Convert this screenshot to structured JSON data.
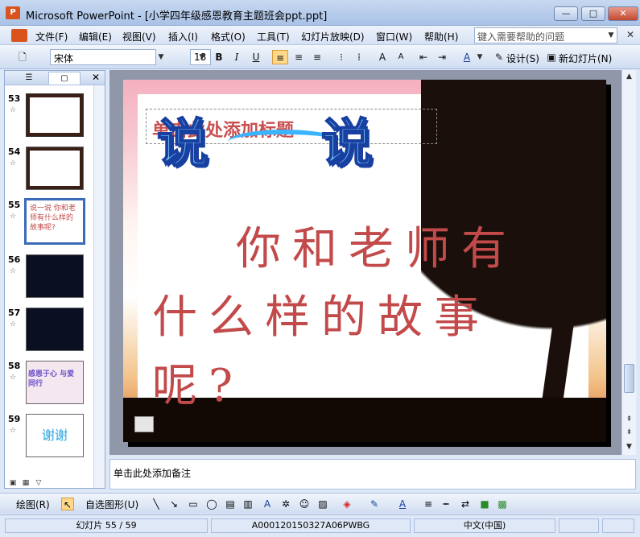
{
  "window": {
    "title": "Microsoft PowerPoint - [小学四年级感恩教育主题班会ppt.ppt]",
    "app_icon_label": "P",
    "minimize": "—",
    "maximize": "□",
    "close": "✕"
  },
  "menu": {
    "items": [
      "文件(F)",
      "编辑(E)",
      "视图(V)",
      "插入(I)",
      "格式(O)",
      "工具(T)",
      "幻灯片放映(D)",
      "窗口(W)",
      "帮助(H)"
    ],
    "help_placeholder": "键入需要帮助的问题",
    "doc_close": "✕"
  },
  "toolbar": {
    "font_name": "宋体",
    "font_size": "18",
    "bold": "B",
    "italic": "I",
    "underline": "U",
    "design_label": "设计(S)",
    "new_slide_label": "新幻灯片(N)"
  },
  "left_pane": {
    "tab_outline": "☰",
    "tab_slides": "▢",
    "close": "✕",
    "thumbnails": [
      {
        "number": "53",
        "label": ""
      },
      {
        "number": "54",
        "label": ""
      },
      {
        "number": "55",
        "label": "说一说  你和老师有什么样的故事呢?"
      },
      {
        "number": "56",
        "label": ""
      },
      {
        "number": "57",
        "label": ""
      },
      {
        "number": "58",
        "label": "感恩于心 与爱同行"
      },
      {
        "number": "59",
        "label": "谢谢"
      }
    ],
    "star": "☆"
  },
  "slide": {
    "placeholder_text": "单击此处添加标题",
    "wordart_char1": "说",
    "wordart_char2": "说",
    "body_line1": "你和老师有",
    "body_line2": "什么样的故事",
    "body_line3": "呢?"
  },
  "notes": {
    "placeholder": "单击此处添加备注"
  },
  "drawing_toolbar": {
    "draw_label": "绘图(R)",
    "autoshapes_label": "自选图形(U)"
  },
  "status": {
    "slide_indicator": "幻灯片 55 / 59",
    "template": "A000120150327A06PWBG",
    "language": "中文(中国)"
  },
  "colors": {
    "accent": "#3a6ab8",
    "body_text": "#c24a4a",
    "wordart_fill": "#7fd0ff",
    "wordart_outline": "#1840a0"
  }
}
